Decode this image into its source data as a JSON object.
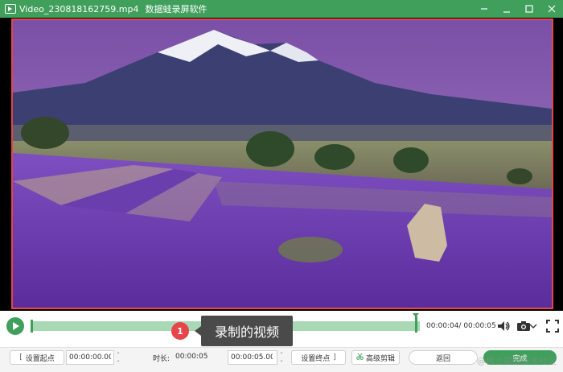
{
  "window": {
    "file_name": "Video_230818162759.mp4",
    "app_name": "数据蛙录屏软件",
    "controls": [
      "minimize-icon",
      "restore-icon",
      "maximize-icon",
      "close-icon"
    ]
  },
  "player": {
    "time_display": "00:00:04/ 00:00:05",
    "progress": 1.0
  },
  "tooltip": {
    "badge": "1",
    "text": "录制的视频"
  },
  "bottom": {
    "set_start_label": "设置起点",
    "start_value": "00:00:00.00",
    "duration_label": "时长:",
    "duration_value": "00:00:05",
    "end_value": "00:00:05.00",
    "set_end_label": "设置终点",
    "advanced_label": "高级剪辑",
    "back_label": "返回",
    "done_label": "完成"
  },
  "watermark": "@稀土掘金技术社区",
  "colors": {
    "brand": "#3f9f5b",
    "highlight_border": "#e8454a",
    "timeline": "#a8d8b4"
  }
}
